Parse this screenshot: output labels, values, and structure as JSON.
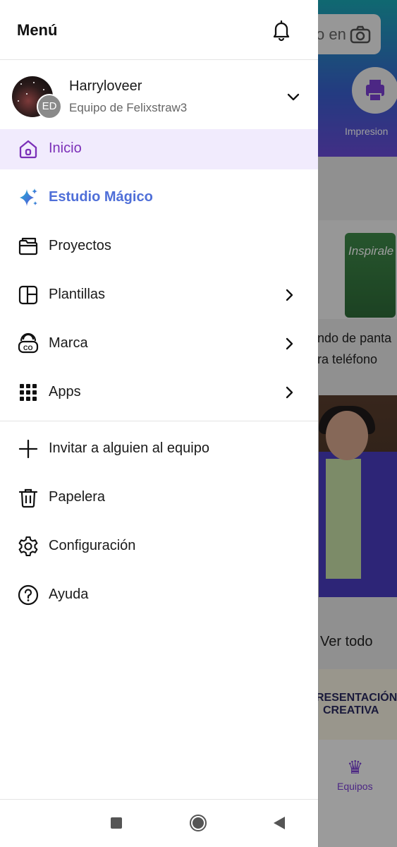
{
  "background": {
    "search_placeholder": "o en",
    "print_label": "Impresion",
    "card1_title_line1": "ondo de panta",
    "card1_title_line2": "ara teléfono",
    "card1_image_text": "Inspirale",
    "see_all": "Ver todo",
    "card3_line1": "RESENTACIÓN",
    "card3_line2": "CREATIVA",
    "bottom_nav_label": "Equipos"
  },
  "drawer": {
    "title": "Menú",
    "account": {
      "name": "Harryloveer",
      "team": "Equipo de Felixstraw3",
      "badge": "ED"
    },
    "items": [
      {
        "label": "Inicio",
        "icon": "home-icon",
        "active": true
      },
      {
        "label": "Estudio Mágico",
        "icon": "sparkles-icon",
        "accent": "#4f6fd8"
      },
      {
        "label": "Proyectos",
        "icon": "folder-icon"
      },
      {
        "label": "Plantillas",
        "icon": "template-icon",
        "chevron": true
      },
      {
        "label": "Marca",
        "icon": "brand-icon",
        "chevron": true
      },
      {
        "label": "Apps",
        "icon": "apps-grid-icon",
        "chevron": true
      }
    ],
    "secondary_items": [
      {
        "label": "Invitar a alguien al equipo",
        "icon": "plus-icon"
      },
      {
        "label": "Papelera",
        "icon": "trash-icon"
      },
      {
        "label": "Configuración",
        "icon": "gear-icon"
      },
      {
        "label": "Ayuda",
        "icon": "help-icon"
      }
    ]
  },
  "colors": {
    "active_bg": "#f1ebfd",
    "active_text": "#7b2fb8",
    "magic_text": "#4f6fd8"
  }
}
